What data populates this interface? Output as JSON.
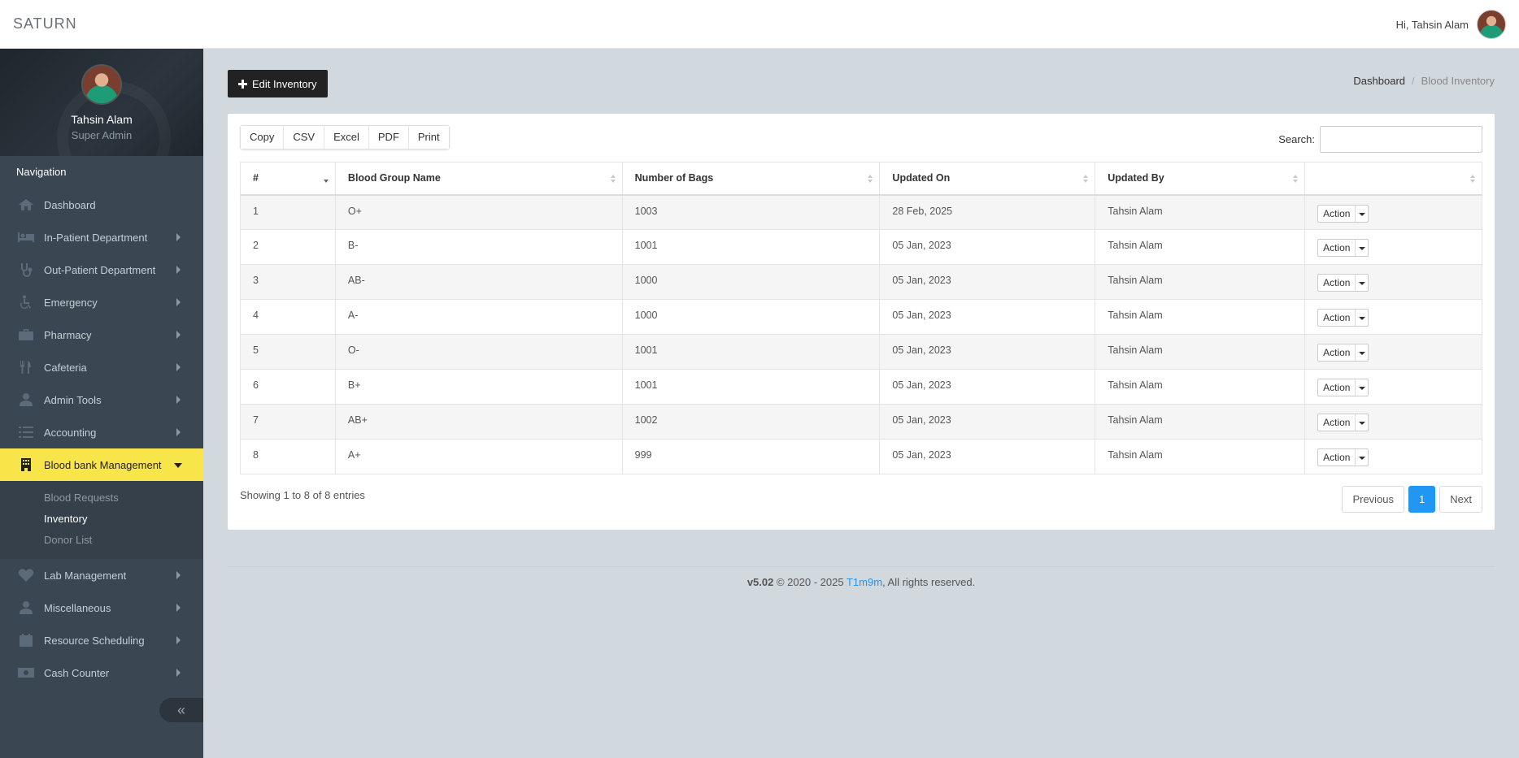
{
  "topbar": {
    "brand": "SATURN",
    "greeting": "Hi, Tahsin Alam"
  },
  "profile": {
    "name": "Tahsin Alam",
    "role": "Super Admin"
  },
  "nav": {
    "heading": "Navigation",
    "items": [
      {
        "label": "Dashboard",
        "icon": "home-icon"
      },
      {
        "label": "In-Patient Department",
        "icon": "bed-icon"
      },
      {
        "label": "Out-Patient Department",
        "icon": "stethoscope-icon"
      },
      {
        "label": "Emergency",
        "icon": "wheelchair-icon"
      },
      {
        "label": "Pharmacy",
        "icon": "medkit-icon"
      },
      {
        "label": "Cafeteria",
        "icon": "cutlery-icon"
      },
      {
        "label": "Admin Tools",
        "icon": "user-icon"
      },
      {
        "label": "Accounting",
        "icon": "list-icon"
      },
      {
        "label": "Blood bank Management",
        "icon": "building-icon"
      },
      {
        "label": "Lab Management",
        "icon": "heartbeat-icon"
      },
      {
        "label": "Miscellaneous",
        "icon": "user-md-icon"
      },
      {
        "label": "Resource Scheduling",
        "icon": "calendar-icon"
      },
      {
        "label": "Cash Counter",
        "icon": "money-icon"
      }
    ],
    "submenu": [
      "Blood Requests",
      "Inventory",
      "Donor List"
    ]
  },
  "page": {
    "edit_button": "Edit Inventory",
    "breadcrumb": [
      "Dashboard",
      "Blood Inventory"
    ]
  },
  "table": {
    "buttons": [
      "Copy",
      "CSV",
      "Excel",
      "PDF",
      "Print"
    ],
    "search_label": "Search:",
    "search_value": "",
    "columns": [
      "#",
      "Blood Group Name",
      "Number of Bags",
      "Updated On",
      "Updated By",
      ""
    ],
    "action_label": "Action",
    "rows": [
      [
        "1",
        "O+",
        "1003",
        "28 Feb, 2025",
        "Tahsin Alam"
      ],
      [
        "2",
        "B-",
        "1001",
        "05 Jan, 2023",
        "Tahsin Alam"
      ],
      [
        "3",
        "AB-",
        "1000",
        "05 Jan, 2023",
        "Tahsin Alam"
      ],
      [
        "4",
        "A-",
        "1000",
        "05 Jan, 2023",
        "Tahsin Alam"
      ],
      [
        "5",
        "O-",
        "1001",
        "05 Jan, 2023",
        "Tahsin Alam"
      ],
      [
        "6",
        "B+",
        "1001",
        "05 Jan, 2023",
        "Tahsin Alam"
      ],
      [
        "7",
        "AB+",
        "1002",
        "05 Jan, 2023",
        "Tahsin Alam"
      ],
      [
        "8",
        "A+",
        "999",
        "05 Jan, 2023",
        "Tahsin Alam"
      ]
    ],
    "info": "Showing 1 to 8 of 8 entries",
    "pager": {
      "prev": "Previous",
      "page": "1",
      "next": "Next"
    }
  },
  "footer": {
    "version": "v5.02",
    "copyright": "© 2020 - 2025",
    "link": "T1m9m",
    "rights": ", All rights reserved."
  },
  "colors": {
    "accent": "#f8e54a",
    "primary": "#2196f3",
    "sidebar": "#3a4651"
  }
}
